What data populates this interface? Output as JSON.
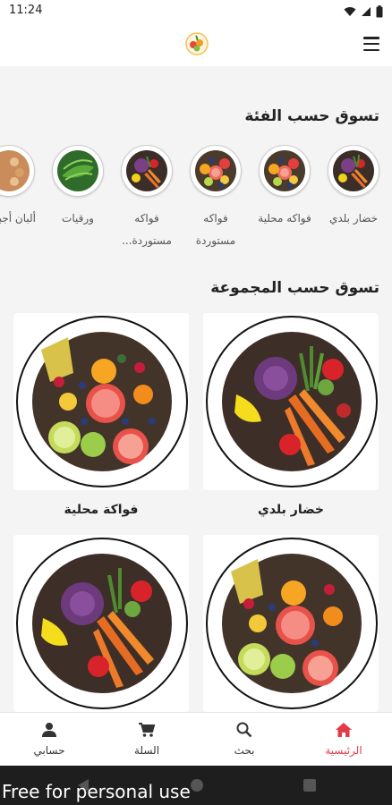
{
  "status": {
    "time": "11:24"
  },
  "header": {
    "logo_icon": "fruit-basket-logo",
    "menu_icon": "hamburger-menu-icon"
  },
  "sections": {
    "categories_title": "تسوق حسب الفئة",
    "groups_title": "تسوق حسب المجموعة"
  },
  "categories": [
    {
      "label": "خضار بلدي",
      "image": "vegetables"
    },
    {
      "label": "فواكه محلية",
      "image": "fruits"
    },
    {
      "label": "فواكه مستوردة",
      "image": "fruits"
    },
    {
      "label": "فواكه مستوردة...",
      "image": "vegetables"
    },
    {
      "label": "ورقيات",
      "image": "greens"
    },
    {
      "label": "ألبان أجبان",
      "image": "dairy"
    }
  ],
  "groups": [
    {
      "label": "خضار بلدي",
      "image": "vegetables"
    },
    {
      "label": "فواكة محلية",
      "image": "fruits"
    },
    {
      "label": "",
      "image": "fruits"
    },
    {
      "label": "",
      "image": "vegetables"
    }
  ],
  "bottom_nav": {
    "items": [
      {
        "label": "الرئيسية",
        "icon": "home-icon",
        "active": true
      },
      {
        "label": "بحث",
        "icon": "search-icon",
        "active": false
      },
      {
        "label": "السلة",
        "icon": "cart-icon",
        "active": false
      },
      {
        "label": "حسابي",
        "icon": "account-icon",
        "active": false
      }
    ]
  },
  "watermark": "Free for personal use",
  "colors": {
    "accent": "#e23b4a",
    "background": "#f4f4f4",
    "card": "#ffffff"
  }
}
